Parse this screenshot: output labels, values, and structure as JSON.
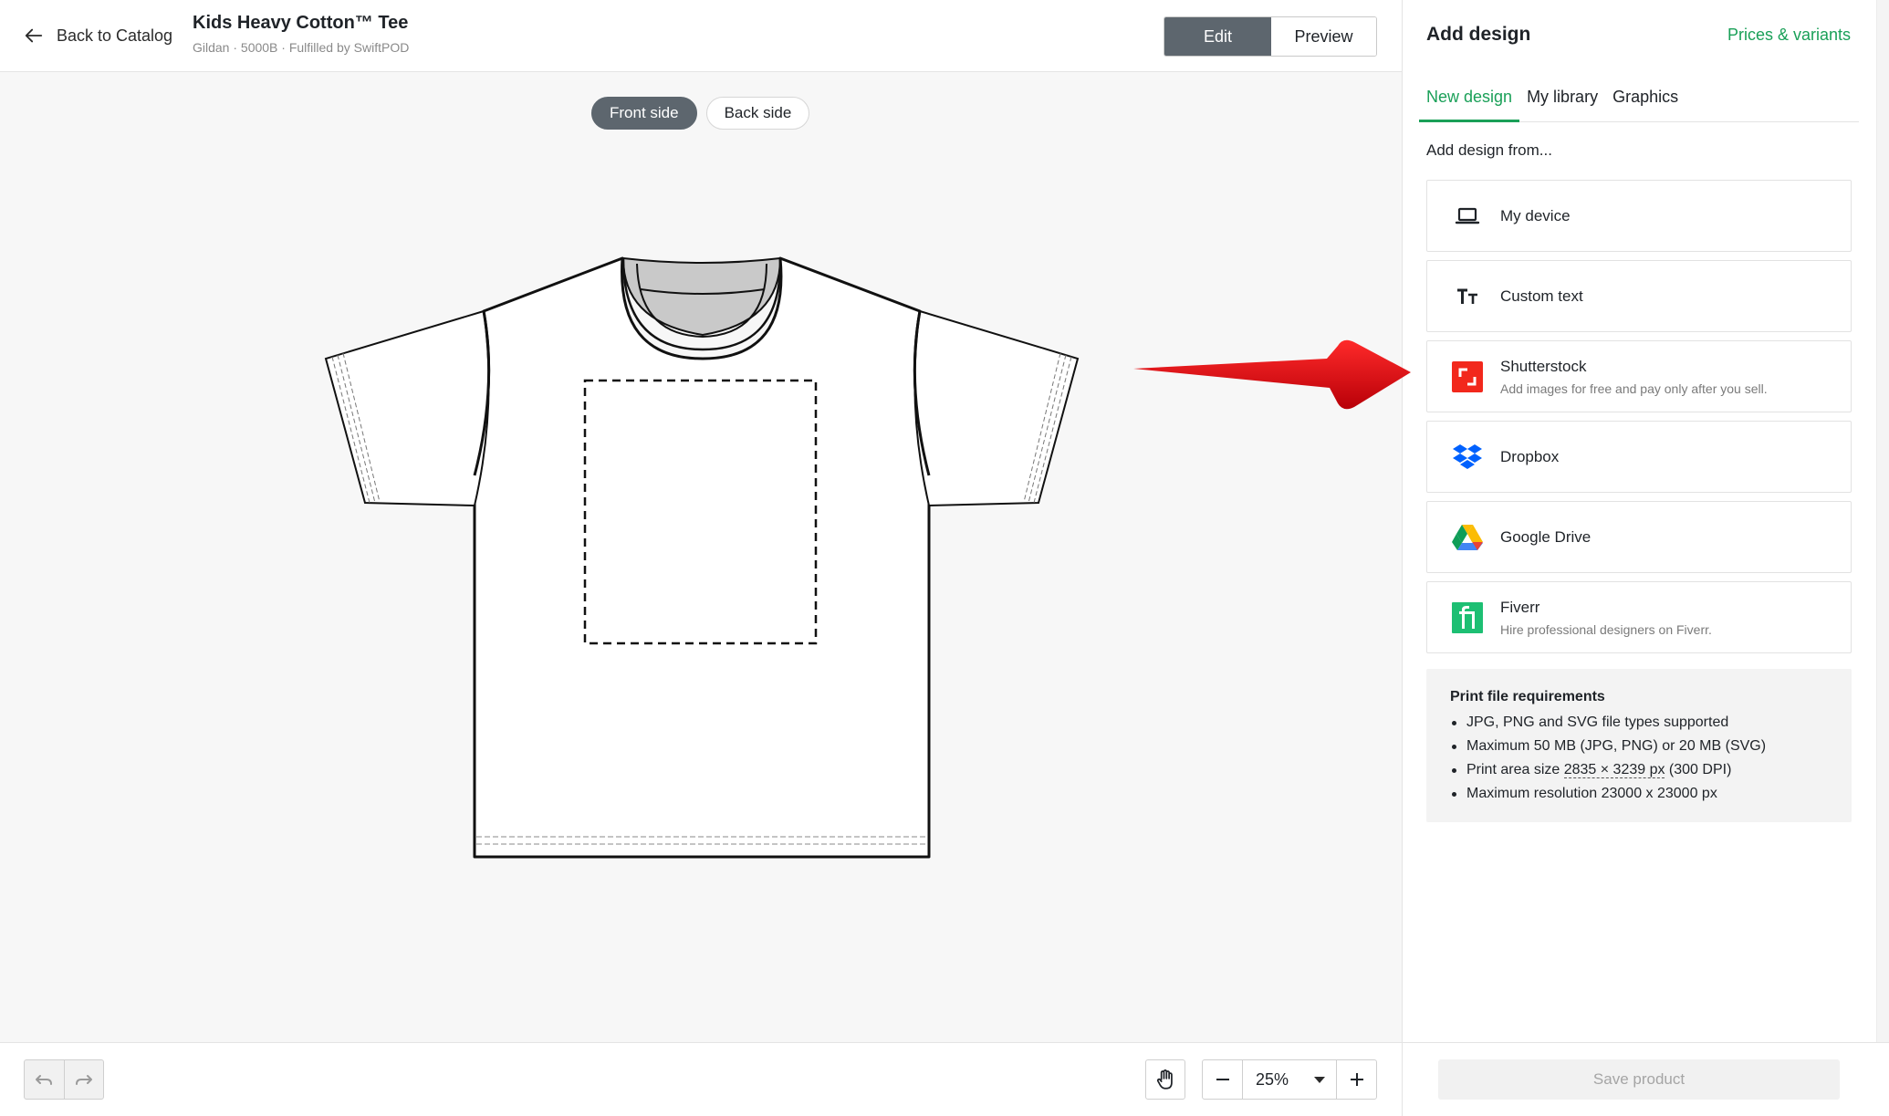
{
  "header": {
    "back_label": "Back to Catalog",
    "product_title": "Kids Heavy Cotton™ Tee",
    "product_subtitle": "Gildan · 5000B · Fulfilled by SwiftPOD",
    "mode_edit": "Edit",
    "mode_preview": "Preview",
    "active_mode": "Edit"
  },
  "canvas": {
    "sides": [
      "Front side",
      "Back side"
    ],
    "active_side": "Front side"
  },
  "toolbar": {
    "zoom_value": "25%",
    "icons": [
      "undo-icon",
      "redo-icon",
      "hand-icon",
      "minus-icon",
      "chevron-down-icon",
      "plus-icon"
    ]
  },
  "panel": {
    "title": "Add design",
    "link": "Prices & variants",
    "tabs": [
      "New design",
      "My library",
      "Graphics"
    ],
    "active_tab": "New design",
    "add_from_label": "Add design from...",
    "sources": [
      {
        "name": "My device",
        "desc": "",
        "icon": "laptop-icon"
      },
      {
        "name": "Custom text",
        "desc": "",
        "icon": "text-icon"
      },
      {
        "name": "Shutterstock",
        "desc": "Add images for free and pay only after you sell.",
        "icon": "shutterstock-icon"
      },
      {
        "name": "Dropbox",
        "desc": "",
        "icon": "dropbox-icon"
      },
      {
        "name": "Google Drive",
        "desc": "",
        "icon": "google-drive-icon"
      },
      {
        "name": "Fiverr",
        "desc": "Hire professional designers on Fiverr.",
        "icon": "fiverr-icon"
      }
    ],
    "requirements": {
      "title": "Print file requirements",
      "items": [
        "JPG, PNG and SVG file types supported",
        "Maximum 50 MB (JPG, PNG) or 20 MB (SVG)",
        "Maximum resolution 23000 x 23000 px"
      ],
      "print_area_prefix": "Print area size ",
      "print_area_value": "2835 × 3239 px",
      "print_area_suffix": " (300 DPI)"
    },
    "save_label": "Save product"
  },
  "colors": {
    "accent_green": "#1aa058",
    "active_dark": "#5d666e",
    "shutterstock_red": "#f2281c",
    "dropbox_blue": "#0061fe",
    "fiverr_green": "#1dbf73",
    "annotation_red": "#d6000a"
  }
}
